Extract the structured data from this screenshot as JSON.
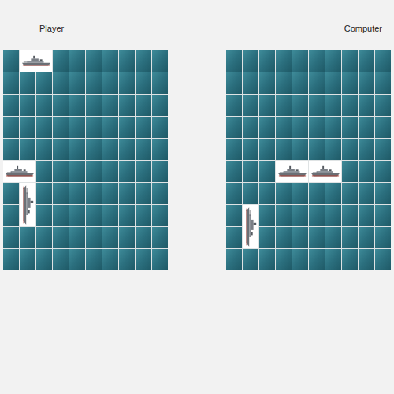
{
  "boards": [
    {
      "label": "Player",
      "ships": [
        {
          "row": 0,
          "col": 1,
          "length": 2,
          "orientation": "horizontal"
        },
        {
          "row": 5,
          "col": 0,
          "length": 2,
          "orientation": "horizontal"
        },
        {
          "row": 6,
          "col": 1,
          "length": 2,
          "orientation": "vertical"
        }
      ]
    },
    {
      "label": "Computer",
      "ships": [
        {
          "row": 5,
          "col": 3,
          "length": 2,
          "orientation": "horizontal"
        },
        {
          "row": 5,
          "col": 5,
          "length": 2,
          "orientation": "horizontal"
        },
        {
          "row": 7,
          "col": 1,
          "length": 2,
          "orientation": "vertical"
        }
      ]
    }
  ]
}
